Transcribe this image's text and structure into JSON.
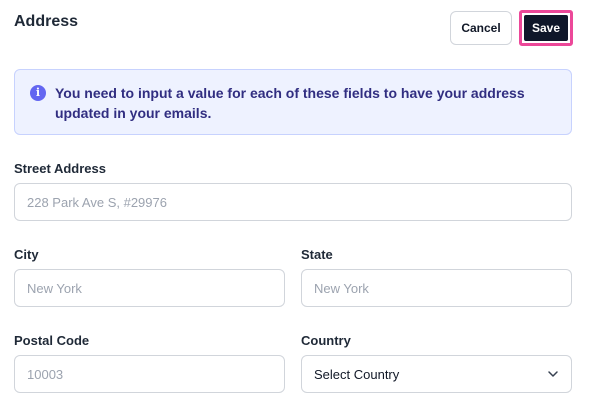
{
  "header": {
    "title": "Address",
    "cancel_label": "Cancel",
    "save_label": "Save"
  },
  "alert": {
    "icon": "info-icon",
    "icon_glyph": "i",
    "message": "You need to input a value for each of these fields to have your address updated in your emails."
  },
  "form": {
    "street": {
      "label": "Street Address",
      "placeholder": "228 Park Ave S, #29976",
      "value": ""
    },
    "city": {
      "label": "City",
      "placeholder": "New York",
      "value": ""
    },
    "state": {
      "label": "State",
      "placeholder": "New York",
      "value": ""
    },
    "postal": {
      "label": "Postal Code",
      "placeholder": "10003",
      "value": ""
    },
    "country": {
      "label": "Country",
      "selected": "Select Country",
      "icon": "chevron-down-icon"
    }
  },
  "colors": {
    "save_bg": "#0f172a",
    "save_highlight": "#ec4899",
    "alert_bg": "#eef2ff",
    "alert_text": "#312e81",
    "info_icon": "#6366f1"
  }
}
